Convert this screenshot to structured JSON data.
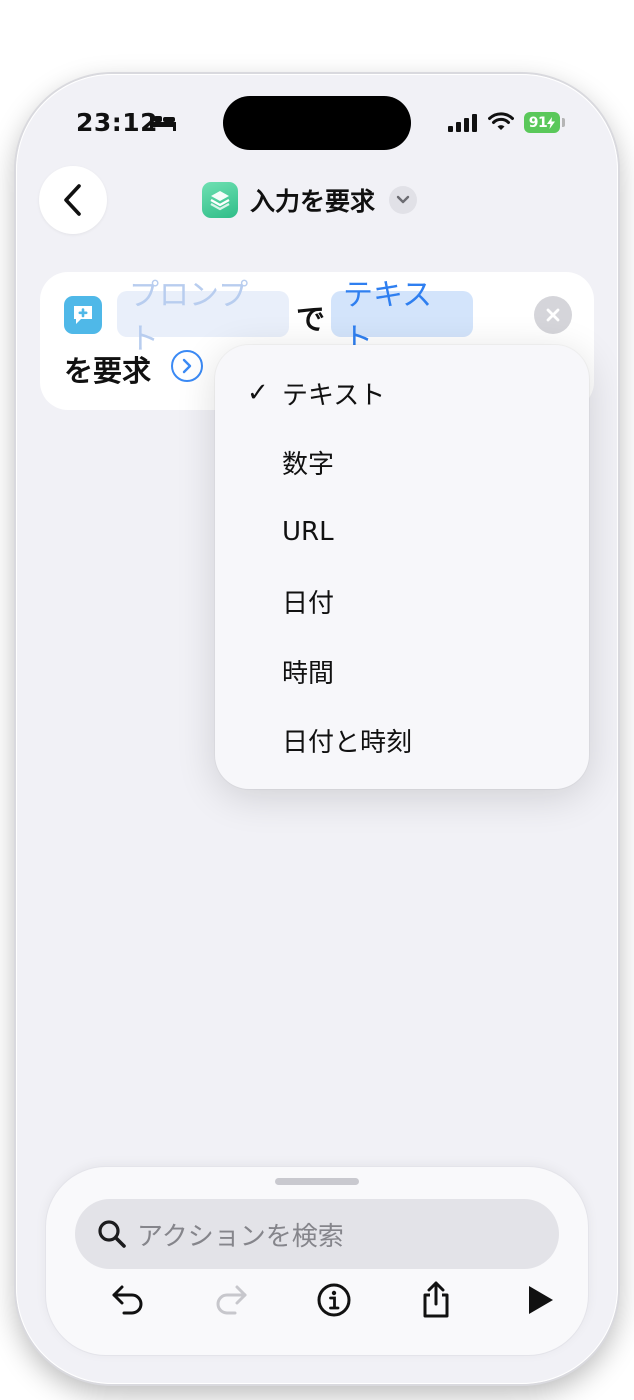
{
  "status_bar": {
    "time": "23:12",
    "battery": "91"
  },
  "nav": {
    "title": "入力を要求",
    "icons": [
      "chevron-left-icon",
      "shortcuts-app-icon",
      "chevron-down-icon"
    ]
  },
  "action": {
    "prompt_token": "プロンプト",
    "connector": "で",
    "type_token": "テキスト",
    "suffix": "を要求"
  },
  "menu": {
    "items": [
      {
        "label": "テキスト",
        "checked": true
      },
      {
        "label": "数字",
        "checked": false
      },
      {
        "label": "URL",
        "checked": false
      },
      {
        "label": "日付",
        "checked": false
      },
      {
        "label": "時間",
        "checked": false
      },
      {
        "label": "日付と時刻",
        "checked": false
      }
    ],
    "check_mark": "✓"
  },
  "bottom": {
    "search_placeholder": "アクションを検索",
    "toolbar_icons": [
      "undo-icon",
      "redo-icon",
      "info-icon",
      "share-icon",
      "play-icon"
    ]
  },
  "colors": {
    "accent": "#2f7ff0",
    "battery": "#5ac85a",
    "app_icon": "#2fbd88",
    "action_icon": "#4fb8e8"
  }
}
